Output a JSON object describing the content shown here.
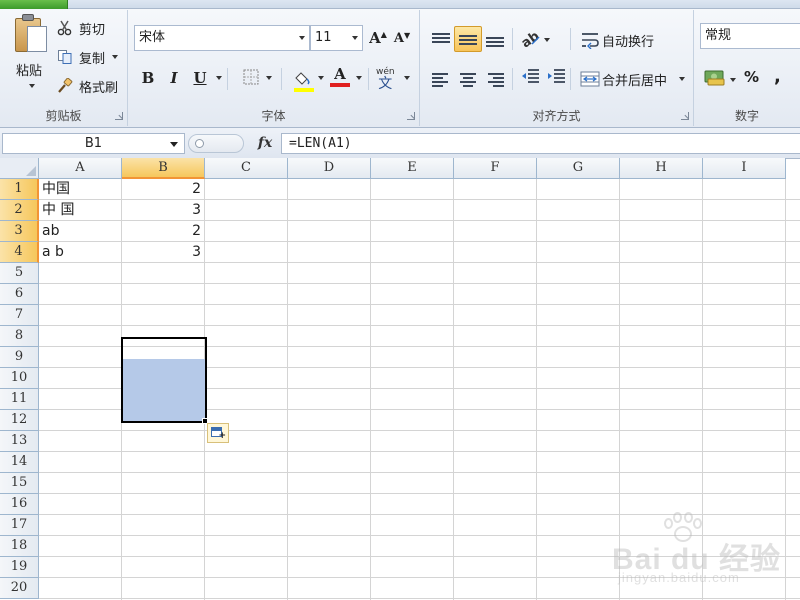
{
  "ribbon": {
    "clipboard": {
      "label": "剪贴板",
      "paste": "粘贴",
      "cut": "剪切",
      "copy": "复制",
      "format_painter": "格式刷"
    },
    "font": {
      "label": "字体",
      "font_name": "宋体",
      "font_size": "11",
      "bold": "B",
      "italic": "I",
      "underline": "U",
      "grow": "A",
      "shrink": "A",
      "font_color_letter": "A",
      "font_color": "#e02020",
      "highlight_color": "#ffff00",
      "phonetic": "wén"
    },
    "alignment": {
      "label": "对齐方式",
      "wrap_text": "自动换行",
      "merge_center": "合并后居中"
    },
    "number": {
      "label": "数字",
      "format": "常规",
      "percent": "%",
      "comma": ","
    }
  },
  "formula_bar": {
    "name_box": "B1",
    "fx": "fx",
    "formula": "=LEN(A1)"
  },
  "sheet": {
    "columns": [
      "A",
      "B",
      "C",
      "D",
      "E",
      "F",
      "G",
      "H",
      "I"
    ],
    "rows": [
      "1",
      "2",
      "3",
      "4",
      "5",
      "6",
      "7",
      "8",
      "9",
      "10",
      "11",
      "12",
      "13",
      "14",
      "15",
      "16",
      "17",
      "18",
      "19",
      "20"
    ],
    "selected_column": "B",
    "selected_rows": [
      "1",
      "2",
      "3",
      "4"
    ],
    "cells": {
      "A1": "中国",
      "A2": "中 国",
      "A3": "ab",
      "A4": "a b",
      "B1": "2",
      "B2": "3",
      "B3": "2",
      "B4": "3"
    }
  },
  "watermark": {
    "logo": "Bai du 经验",
    "url": "jingyan.baidu.com"
  }
}
